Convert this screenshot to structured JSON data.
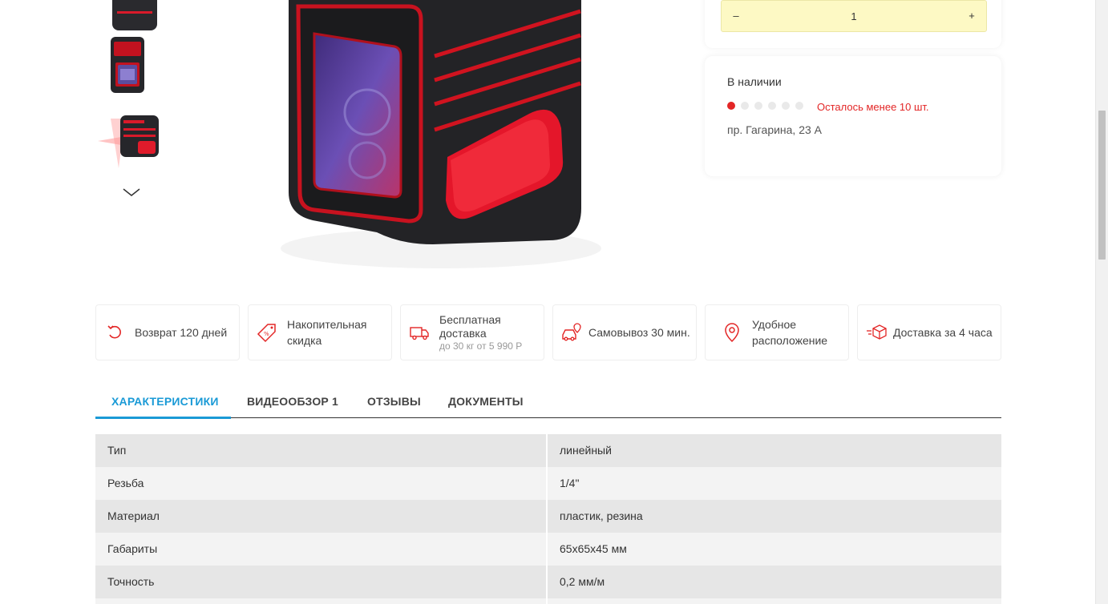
{
  "quantity": {
    "minus_label": "–",
    "value": "1",
    "plus_label": "+"
  },
  "stock": {
    "title": "В наличии",
    "level_filled": 1,
    "level_total": 6,
    "warning": "Осталось менее 10 шт.",
    "address": "пр. Гагарина, 23 А"
  },
  "benefits": [
    {
      "icon": "return-arrow-icon",
      "label": "Возврат 120 дней"
    },
    {
      "icon": "discount-tag-icon",
      "label": "Накопительная скидка"
    },
    {
      "icon": "delivery-truck-icon",
      "label": "Бесплатная доставка",
      "sub": "до 30 кг от 5 990 Р"
    },
    {
      "icon": "car-pickup-icon",
      "label": "Самовывоз 30 мин."
    },
    {
      "icon": "location-pin-icon",
      "label": "Удобное расположение"
    },
    {
      "icon": "fast-box-icon",
      "label": "Доставка за 4 часа"
    }
  ],
  "tabs": [
    {
      "label": "ХАРАКТЕРИСТИКИ",
      "active": true
    },
    {
      "label": "ВИДЕООБЗОР 1",
      "active": false
    },
    {
      "label": "ОТЗЫВЫ",
      "active": false
    },
    {
      "label": "ДОКУМЕНТЫ",
      "active": false
    }
  ],
  "specs": [
    {
      "name": "Тип",
      "value": "линейный"
    },
    {
      "name": "Резьба",
      "value": "1/4\""
    },
    {
      "name": "Материал",
      "value": "пластик, резина"
    },
    {
      "name": "Габариты",
      "value": "65х65х45 мм"
    },
    {
      "name": "Точность",
      "value": "0,2 мм/м"
    }
  ],
  "colors": {
    "accent": "#1a9ad6",
    "alert": "#e32626",
    "qty_bg": "#fdf9c4"
  }
}
